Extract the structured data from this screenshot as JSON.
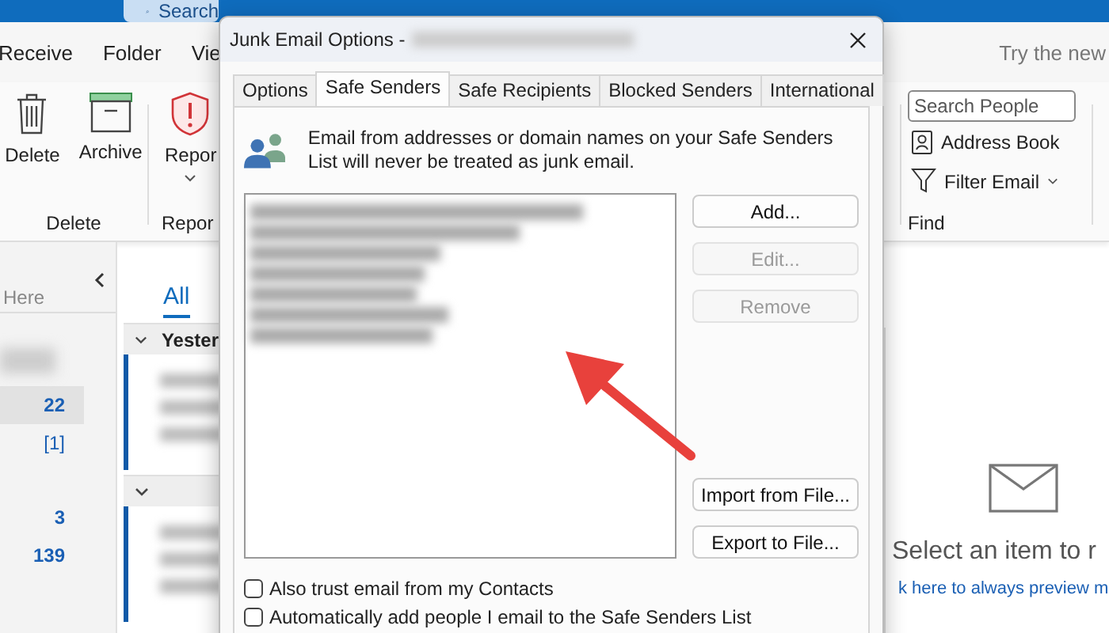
{
  "top_bar": {
    "search": {
      "placeholder": "Search"
    }
  },
  "ribbon_tabs": [
    {
      "label": "Receive"
    },
    {
      "label": "Folder"
    },
    {
      "label": "Vie"
    }
  ],
  "try_new": "Try the new",
  "ribbon": {
    "delete_group": {
      "label": "Delete",
      "buttons": [
        {
          "label": "Delete",
          "kind": "trash"
        },
        {
          "label": "Archive",
          "kind": "archive"
        }
      ]
    },
    "report_group": {
      "label": "Repor",
      "button": "Repor"
    },
    "find_group": {
      "label": "Find",
      "search": {
        "placeholder": "Search People"
      },
      "buttons": [
        {
          "label": "Address Book",
          "kind": "address-book"
        },
        {
          "label": "Filter Email",
          "kind": "filter"
        }
      ]
    }
  },
  "folder_pane": {
    "search_hint": "Here",
    "folders": [
      {
        "count": "22",
        "selected": true
      },
      {
        "count": "[1]",
        "selected": false
      },
      {
        "count": "3",
        "selected": false
      },
      {
        "count": "139",
        "selected": false
      }
    ]
  },
  "message_list": {
    "filter_tab": "All",
    "groups": [
      {
        "label": "Yester",
        "expanded": true
      },
      {
        "expanded": true
      }
    ]
  },
  "reading_pane": {
    "message": "Select an item to r",
    "link": "k here to always preview m"
  },
  "dialog": {
    "title": "Junk Email Options -",
    "tabs": [
      {
        "label": "Options",
        "selected": false
      },
      {
        "label": "Safe Senders",
        "selected": true
      },
      {
        "label": "Safe Recipients",
        "selected": false
      },
      {
        "label": "Blocked Senders",
        "selected": false
      },
      {
        "label": "International",
        "selected": false
      }
    ],
    "description": "Email from addresses or domain names on your Safe Senders List will never be treated as junk email.",
    "senders": [
      {
        "kind": "blurred"
      },
      {
        "kind": "blurred"
      },
      {
        "kind": "blurred"
      },
      {
        "kind": "blurred"
      },
      {
        "kind": "blurred"
      },
      {
        "kind": "blurred"
      },
      {
        "kind": "blurred"
      }
    ],
    "buttons_top": [
      {
        "label": "Add...",
        "disabled": false
      },
      {
        "label": "Edit...",
        "disabled": true
      },
      {
        "label": "Remove",
        "disabled": true
      }
    ],
    "buttons_bottom": [
      {
        "label": "Import from File...",
        "disabled": false
      },
      {
        "label": "Export to File...",
        "disabled": false
      }
    ],
    "checkboxes": [
      {
        "label": "Also trust email from my Contacts",
        "checked": false
      },
      {
        "label": "Automatically add people I email to the Safe Senders List",
        "checked": false
      }
    ]
  },
  "annotation": {
    "kind": "arrow"
  }
}
